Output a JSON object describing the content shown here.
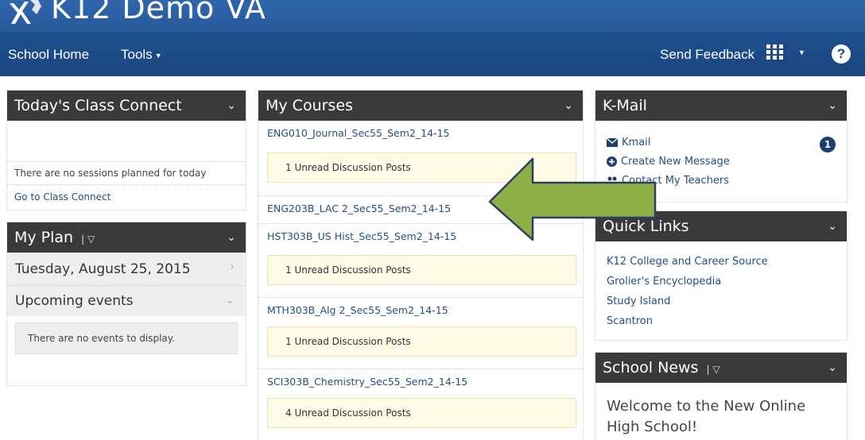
{
  "header": {
    "school_name": "K12 Demo VA",
    "nav": {
      "home": "School Home",
      "tools": "Tools",
      "feedback": "Send Feedback",
      "help": "?"
    }
  },
  "class_connect": {
    "title": "Today's Class Connect",
    "empty": "There are no sessions planned for today",
    "link": "Go to Class Connect"
  },
  "my_plan": {
    "title": "My Plan",
    "date": "Tuesday, August 25, 2015",
    "upcoming": "Upcoming events",
    "no_events": "There are no events to display."
  },
  "my_courses": {
    "title": "My Courses",
    "courses": [
      {
        "name": "ENG010_Journal_Sec55_Sem2_14-15",
        "unread": "1 Unread Discussion Posts"
      },
      {
        "name": "ENG203B_LAC 2_Sec55_Sem2_14-15",
        "unread": ""
      },
      {
        "name": "HST303B_US Hist_Sec55_Sem2_14-15",
        "unread": "1 Unread Discussion Posts"
      },
      {
        "name": "MTH303B_Alg 2_Sec55_Sem2_14-15",
        "unread": "1 Unread Discussion Posts"
      },
      {
        "name": "SCI303B_Chemistry_Sec55_Sem2_14-15",
        "unread": "4 Unread Discussion Posts"
      }
    ]
  },
  "kmail": {
    "title": "K-Mail",
    "kmail_link": "Kmail",
    "unread_count": "1",
    "create": "Create New Message",
    "contact": "Contact My Teachers"
  },
  "quick_links": {
    "title": "Quick Links",
    "links": [
      "K12 College and Career Source",
      "Grolier's Encyclopedia",
      "Study Island",
      "Scantron"
    ]
  },
  "school_news": {
    "title": "School News",
    "headline": "Welcome to the New Online High School!"
  },
  "colors": {
    "nav_blue": "#1b467f",
    "panel_header": "#3a3a3a",
    "link": "#23507e",
    "unread_bg": "#fffbe6",
    "arrow_green": "#8db046"
  }
}
